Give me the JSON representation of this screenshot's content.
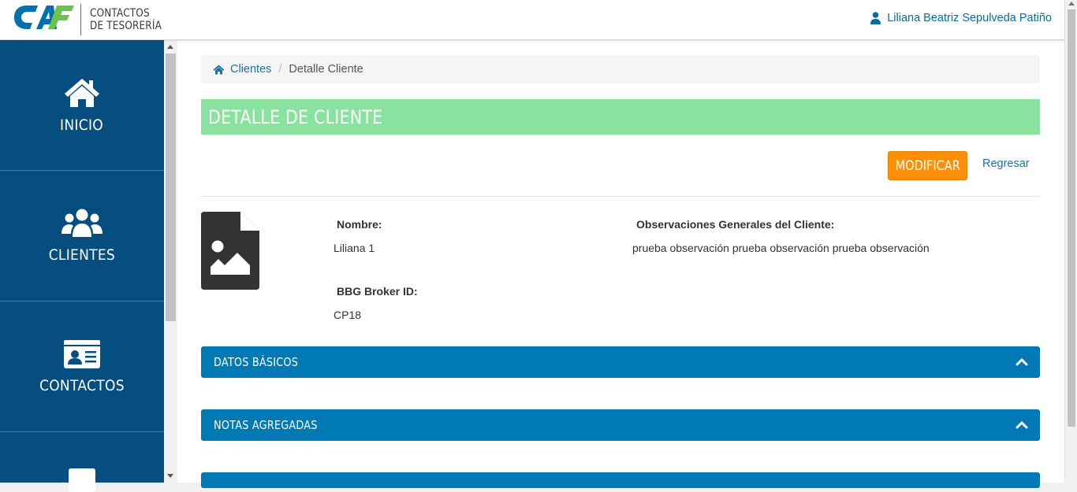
{
  "header": {
    "logo_mark": "CAF",
    "logo_text_line1": "CONTACTOS",
    "logo_text_line2": "DE TESORERÍA",
    "user_name": "Liliana Beatriz Sepulveda Patiño"
  },
  "sidebar": {
    "items": [
      {
        "label": "INICIO",
        "icon": "home-icon"
      },
      {
        "label": "CLIENTES",
        "icon": "users-icon"
      },
      {
        "label": "CONTACTOS",
        "icon": "id-card-icon"
      }
    ]
  },
  "breadcrumb": {
    "home_label": "Clientes",
    "separator": "/",
    "current": "Detalle Cliente"
  },
  "page": {
    "title": "DETALLE DE CLIENTE",
    "modify_button": "MODIFICAR",
    "back_link": "Regresar"
  },
  "client": {
    "name_label": "Nombre:",
    "name_value": "Liliana 1",
    "broker_label": "BBG Broker ID:",
    "broker_value": "CP18",
    "observations_label": "Observaciones Generales del Cliente:",
    "observations_value": "prueba observación prueba observación prueba observación",
    "image_icon": "file-image-icon"
  },
  "panels": [
    {
      "title": "DATOS BÁSICOS",
      "state": "expanded"
    },
    {
      "title": "NOTAS AGREGADAS",
      "state": "expanded"
    }
  ],
  "colors": {
    "sidebar": "#064e7f",
    "title_bar": "#8ae29f",
    "accent_button": "#ff8f06",
    "panel": "#0079b5",
    "link": "#1a73a8"
  }
}
